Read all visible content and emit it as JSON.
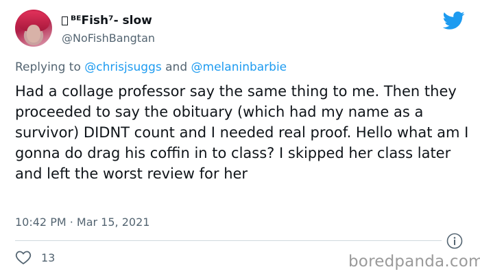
{
  "author": {
    "display_name": "ᴮᴱFish⁷- slow",
    "handle": "@NoFishBangtan"
  },
  "reply": {
    "prefix": "Replying to",
    "mention_1": "@chrisjsuggs",
    "conjunction": "and",
    "mention_2": "@melaninbarbie"
  },
  "tweet": {
    "text": "Had a collage professor say the same thing to me. Then they proceeded to say the obituary (which had my name as a survivor) DIDNT count and I needed real proof. Hello what am I gonna do drag his coffin in to class? I skipped her class later and left the worst review for her",
    "timestamp": "10:42 PM · Mar 15, 2021",
    "likes": "13"
  },
  "watermark": "boredpanda.com",
  "icons": {
    "logo": "twitter-bird-icon",
    "info": "info-icon",
    "like": "heart-icon"
  },
  "colors": {
    "twitter_blue": "#1d9bf0",
    "secondary_text": "#536471"
  }
}
